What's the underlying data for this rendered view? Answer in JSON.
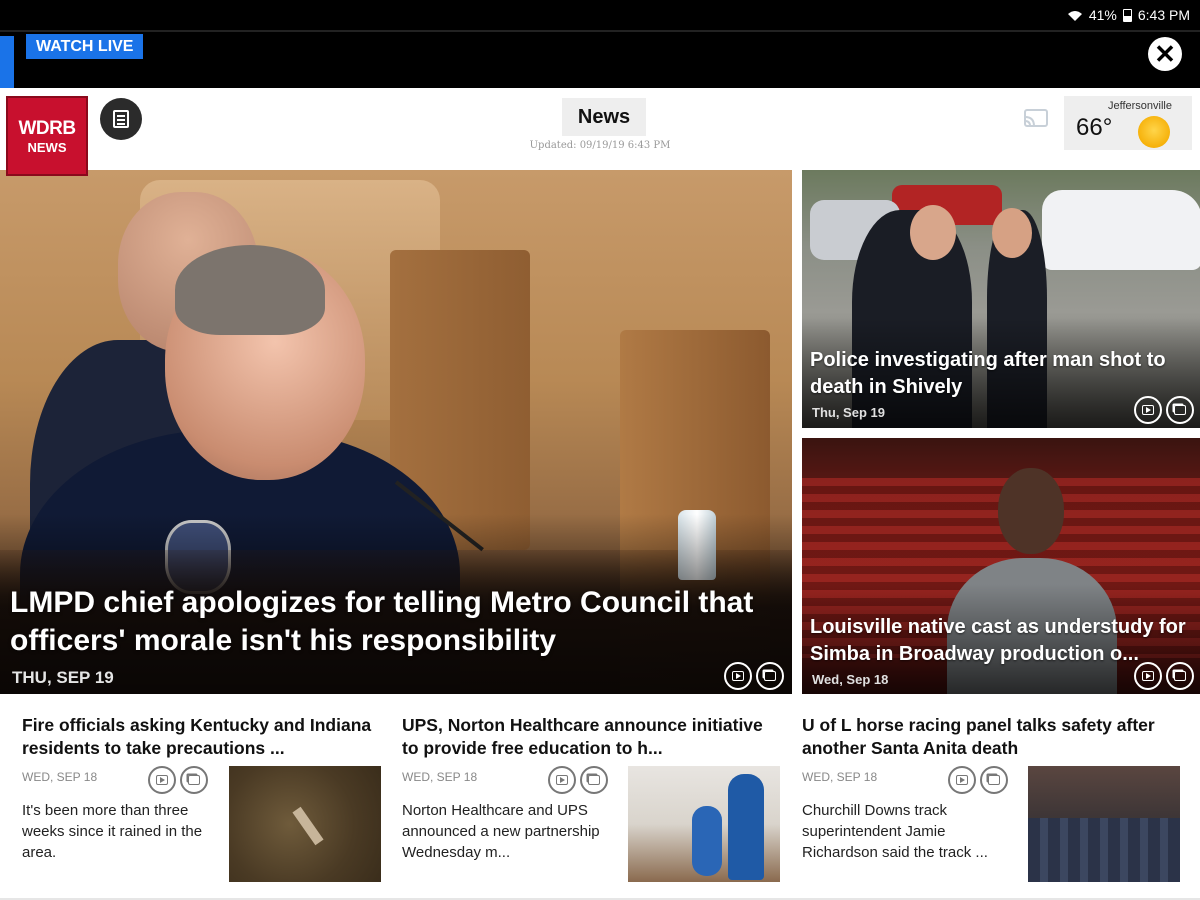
{
  "status_bar": {
    "battery": "41%",
    "time": "6:43 PM"
  },
  "live_bar": {
    "watch_live": "WATCH LIVE",
    "close": "✕"
  },
  "header": {
    "logo_line1": "WDRB",
    "logo_line2": "NEWS",
    "section": "News",
    "updated": "Updated: 09/19/19 6:43 PM",
    "weather": {
      "city": "Jeffersonville",
      "temp": "66°",
      "icon": "sun-icon"
    }
  },
  "hero": {
    "title": "LMPD chief apologizes for telling Metro Council that officers' morale isn't his responsibility",
    "date": "THU, SEP 19"
  },
  "side_cards": [
    {
      "title": "Police investigating after man shot to death in Shively",
      "date": "Thu, Sep 19"
    },
    {
      "title": "Louisville native cast as understudy for Simba in Broadway production o...",
      "date": "Wed, Sep 18"
    }
  ],
  "articles": [
    {
      "title": "Fire officials asking Kentucky and Indiana residents to take precautions ...",
      "date": "WED, SEP 18",
      "desc": "It's been more than three weeks since it rained in the area."
    },
    {
      "title": "UPS, Norton Healthcare announce initiative to provide free education to h...",
      "date": "WED, SEP 18",
      "desc": "Norton Healthcare and UPS announced a new partnership Wednesday m..."
    },
    {
      "title": "U of L horse racing panel talks safety after another Santa Anita death",
      "date": "WED, SEP 18",
      "desc": "Churchill Downs track superintendent Jamie Richardson said the track ..."
    }
  ],
  "colors": {
    "accent": "#1a73e8",
    "brand_red": "#c8102e"
  }
}
